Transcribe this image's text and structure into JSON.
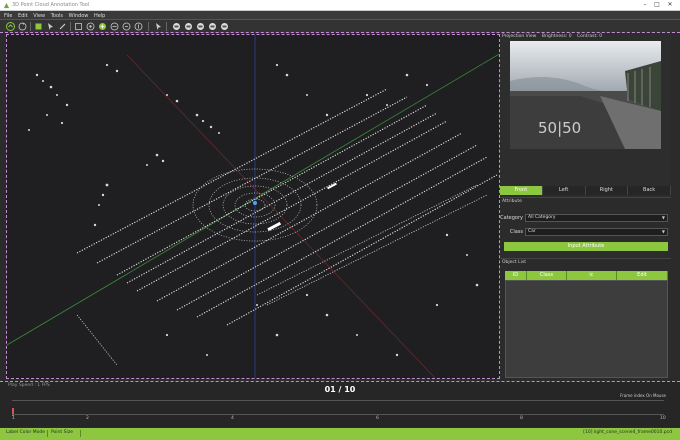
{
  "window": {
    "title": "3D Point Cloud Annotation Tool",
    "controls": [
      "–",
      "□",
      "✕"
    ]
  },
  "menu": [
    "File",
    "Edit",
    "View",
    "Tools",
    "Window",
    "Help"
  ],
  "toolbar": {
    "icons": [
      "home-icon",
      "rotate-icon",
      "cube-icon",
      "cursor-icon",
      "pen-icon",
      "box-icon",
      "select-icon",
      "zoom-in-icon",
      "zoom-out-icon",
      "pan-icon",
      "move-icon",
      "car-icon",
      "car-icon",
      "car-icon",
      "car-icon"
    ]
  },
  "projection": {
    "tab_label": "Projection View",
    "brightness_label": "Brightness: 0",
    "contrast_label": "Contrast: 0",
    "road_marking": "50|50"
  },
  "view_tabs": {
    "active": "Front",
    "items": [
      "Front",
      "Left",
      "Right",
      "Back"
    ]
  },
  "attribute": {
    "title": "Attribute",
    "category_label": "Category",
    "category_value": "All Category",
    "class_label": "Class",
    "class_value": "Car",
    "input_button": "Input Attribute"
  },
  "object_list": {
    "title": "Object List",
    "columns": [
      "ID",
      "Class",
      "ic",
      "Edit"
    ]
  },
  "timeline": {
    "fps_label": "Play Speed : 1 FPS",
    "frame_counter": "01 / 10",
    "frame_note": "Frame index On Mouse",
    "ticks": [
      "1",
      "2",
      "4",
      "6",
      "8",
      "10"
    ]
  },
  "status": {
    "left1": "Label Color Mode",
    "left2": "Point Size",
    "right": "[10] light_cone_scene4_frame0010.pcd"
  },
  "colors": {
    "accent": "#8dc63f",
    "guide": "#c68bd6",
    "background": "#1f1f22"
  }
}
